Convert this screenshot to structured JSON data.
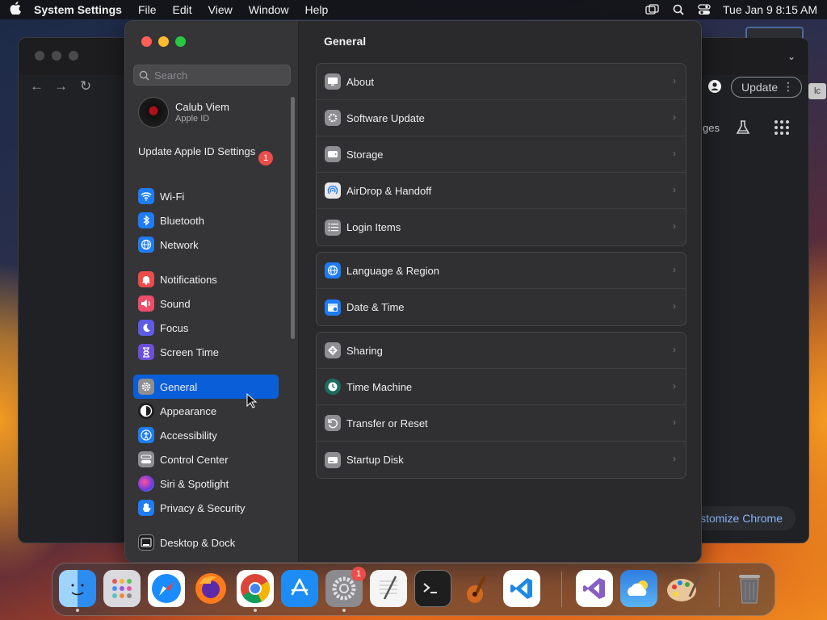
{
  "menubar": {
    "app_name": "System Settings",
    "menus": [
      "File",
      "Edit",
      "View",
      "Window",
      "Help"
    ],
    "clock": "Tue Jan 9  8:15 AM"
  },
  "chrome": {
    "update_label": "Update",
    "partial_label": "ges",
    "customize_label": "ustomize Chrome",
    "side_badge": "lc"
  },
  "sidebar": {
    "search_placeholder": "Search",
    "account": {
      "name": "Calub Viem",
      "subtitle": "Apple ID"
    },
    "update_appleid": {
      "label": "Update Apple ID Settings",
      "badge": "1"
    },
    "group1": [
      {
        "label": "Wi-Fi",
        "icon": "wifi-icon",
        "color": "#1f7cf5"
      },
      {
        "label": "Bluetooth",
        "icon": "bluetooth-icon",
        "color": "#1f7cf5"
      },
      {
        "label": "Network",
        "icon": "globe-icon",
        "color": "#1f7cf5"
      }
    ],
    "group2": [
      {
        "label": "Notifications",
        "icon": "bell-icon",
        "color": "#eb4d4b"
      },
      {
        "label": "Sound",
        "icon": "speaker-icon",
        "color": "#eb4d6a"
      },
      {
        "label": "Focus",
        "icon": "moon-icon",
        "color": "#5e5ce6"
      },
      {
        "label": "Screen Time",
        "icon": "hourglass-icon",
        "color": "#6b4fd9"
      }
    ],
    "group3": [
      {
        "label": "General",
        "icon": "gear-icon",
        "color": "#8e8e93",
        "selected": true
      },
      {
        "label": "Appearance",
        "icon": "appearance-icon",
        "color": "#1c1c1e"
      },
      {
        "label": "Accessibility",
        "icon": "accessibility-icon",
        "color": "#1f7cf5"
      },
      {
        "label": "Control Center",
        "icon": "control-center-icon",
        "color": "#8e8e93"
      },
      {
        "label": "Siri & Spotlight",
        "icon": "siri-icon",
        "color": "#a23bd6"
      },
      {
        "label": "Privacy & Security",
        "icon": "hand-icon",
        "color": "#1f7cf5"
      }
    ],
    "group4": [
      {
        "label": "Desktop & Dock",
        "icon": "dock-icon",
        "color": "#1c1c1e"
      }
    ]
  },
  "main": {
    "title": "General",
    "groups": [
      [
        {
          "label": "About",
          "icon": "display-icon",
          "color": "#8e8e93"
        },
        {
          "label": "Software Update",
          "icon": "gear-badge-icon",
          "color": "#8e8e93"
        },
        {
          "label": "Storage",
          "icon": "storage-icon",
          "color": "#8e8e93"
        },
        {
          "label": "AirDrop & Handoff",
          "icon": "airdrop-icon",
          "color": "#e8e8ea"
        },
        {
          "label": "Login Items",
          "icon": "list-icon",
          "color": "#8e8e93"
        }
      ],
      [
        {
          "label": "Language & Region",
          "icon": "globe-icon",
          "color": "#1f7cf5"
        },
        {
          "label": "Date & Time",
          "icon": "calendar-icon",
          "color": "#1f7cf5"
        }
      ],
      [
        {
          "label": "Sharing",
          "icon": "sharing-icon",
          "color": "#8e8e93"
        },
        {
          "label": "Time Machine",
          "icon": "clock-icon",
          "color": "#1c6b5e"
        },
        {
          "label": "Transfer or Reset",
          "icon": "reset-icon",
          "color": "#8e8e93"
        },
        {
          "label": "Startup Disk",
          "icon": "disk-icon",
          "color": "#8e8e93"
        }
      ]
    ]
  },
  "dock": {
    "apps": [
      {
        "name": "finder-icon",
        "color": "#2d8cf0",
        "running": true
      },
      {
        "name": "launchpad-icon",
        "color": "#d9d9de",
        "running": false
      },
      {
        "name": "safari-icon",
        "color": "#1a8cff",
        "running": false
      },
      {
        "name": "firefox-icon",
        "color": "#ff7a1a",
        "running": false
      },
      {
        "name": "chrome-icon",
        "color": "#ffffff",
        "running": true
      },
      {
        "name": "app-store-icon",
        "color": "#1d8df5",
        "running": false
      },
      {
        "name": "system-settings-icon",
        "color": "#8a8a8f",
        "running": true,
        "badge": "1"
      },
      {
        "name": "textedit-icon",
        "color": "#f5f5f5",
        "running": false
      },
      {
        "name": "terminal-icon",
        "color": "#1e1e1e",
        "running": false
      },
      {
        "name": "garageband-icon",
        "color": "#3a3a3a",
        "running": false
      },
      {
        "name": "vscode-icon",
        "color": "#ffffff",
        "running": false
      },
      {
        "name": "visual-studio-icon",
        "color": "#ffffff",
        "running": false
      },
      {
        "name": "weather-icon",
        "color": "#3a8ee6",
        "running": false
      },
      {
        "name": "paint-icon",
        "color": "#c9a36b",
        "running": false
      },
      {
        "name": "trash-icon",
        "color": "#5a5a5e",
        "running": false
      }
    ]
  }
}
